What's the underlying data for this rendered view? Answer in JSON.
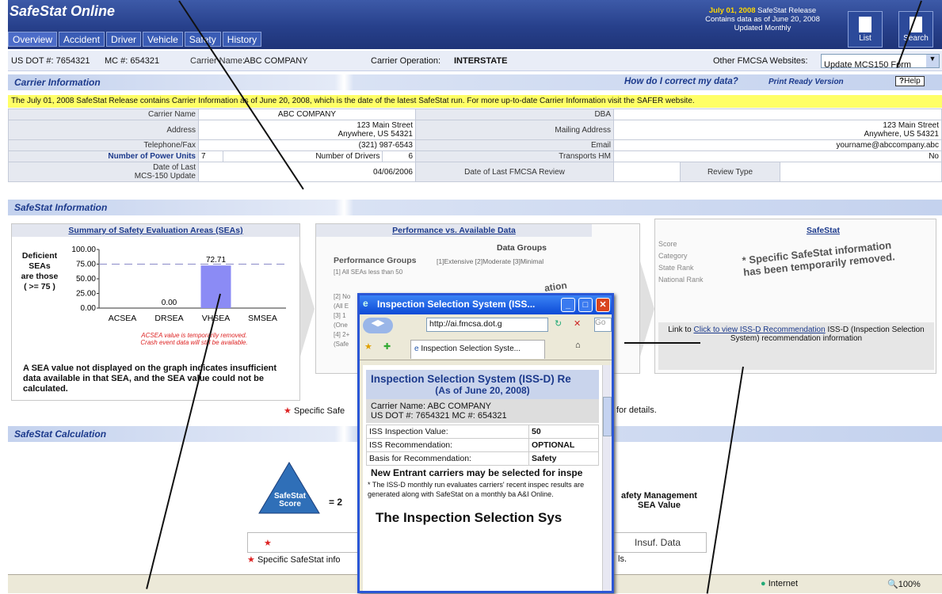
{
  "header": {
    "title": "SafeStat Online",
    "tabs": [
      "Overview",
      "Accident",
      "Driver",
      "Vehicle",
      "Safety",
      "History"
    ],
    "release_line1": "July 01, 2008",
    "release_line1b": "SafeStat Release",
    "release_line2": "Contains data as of June 20, 2008",
    "release_line3": "Updated Monthly",
    "list_label": "List",
    "search_label": "Search"
  },
  "carrier_row": {
    "usdot": "US DOT #: 7654321",
    "mc": "MC #: 654321",
    "name_label": "Carrier Name:",
    "name": "ABC COMPANY",
    "operation_label": "Carrier Operation:",
    "operation": "INTERSTATE",
    "websites_label": "Other FMCSA Websites:",
    "websites_value": "Update MCS150 Form"
  },
  "carrier_info": {
    "title": "Carrier Information",
    "correct_link": "How do I correct my data?",
    "print_link": "Print Ready Version",
    "help": "Help",
    "notice": "The July 01, 2008 SafeStat Release contains Carrier Information as of June 20, 2008, which is the date of the latest SafeStat run.  For more up-to-date Carrier Information visit the SAFER website.",
    "carrier_name_label": "Carrier Name",
    "carrier_name": "ABC COMPANY",
    "dba_label": "DBA",
    "dba": "",
    "address_label": "Address",
    "address1": "123 Main Street",
    "address2": "Anywhere, US 54321",
    "mailing_label": "Mailing Address",
    "mailing1": "123 Main Street",
    "mailing2": "Anywhere, US 54321",
    "phone_label": "Telephone/Fax",
    "phone": "(321) 987-6543",
    "email_label": "Email",
    "email": "yourname@abccompany.abc",
    "power_units_label": "Number of Power Units",
    "power_units": "7",
    "drivers_label": "Number of Drivers",
    "drivers": "6",
    "hm_label": "Transports HM",
    "hm": "No",
    "mcs_label1": "Date of Last",
    "mcs_label2": "MCS-150 Update",
    "mcs_date": "04/06/2006",
    "review_label": "Date of Last FMCSA Review",
    "review": "",
    "review_type_label": "Review Type",
    "review_type": ""
  },
  "safestat_info": {
    "title": "SafeStat Information",
    "sea_panel_title": "Summary of Safety Evaluation Areas (SEAs)",
    "deficient_text": [
      "Deficient",
      "SEAs",
      "are those",
      "( >= 75 )"
    ],
    "sea_note_red1": "ACSEA value is temporarily removed.",
    "sea_note_red2": "Crash event data will still be available.",
    "sea_note": "A SEA value not displayed on the graph indicates insufficient data available in that SEA, and the SEA value could not be calculated.",
    "perf_title": "Performance vs. Available Data",
    "data_groups": "Data Groups",
    "perf_groups": "Performance Groups",
    "dg_cols": "[1]Extensive [2]Moderate [3]Minimal",
    "perf_rows": [
      "[1] All SEAs less than 50",
      "[2] No",
      "(All E",
      "[3] 1",
      "(One",
      "[4] 2+",
      "(Safe"
    ],
    "perf_overlay": "ation",
    "ss_title": "SafeStat",
    "ss_labels": [
      "Score",
      "Category",
      "State Rank",
      "National Rank"
    ],
    "removed_text": "* Specific SafeStat information has been temporarily removed.",
    "link_pre": "Link to",
    "link_text": "Click to view ISS-D Recommendation",
    "link_post": "ISS-D (Inspection Selection System) recommendation information",
    "footnote": "Specific Safe",
    "footnote_end": "for details."
  },
  "calc": {
    "title": "SafeStat Calculation",
    "score_label": "SafeStat Score",
    "eq": "= 2",
    "sm_label": "afety Management SEA Value",
    "insuf": "Insuf. Data",
    "star": "★",
    "footnote": "Specific SafeStat info",
    "footnote_end": "ls."
  },
  "popup": {
    "window_title": "Inspection Selection System (ISS...",
    "url": "http://ai.fmcsa.dot.g",
    "search_placeholder": "Go",
    "tab_label": "Inspection Selection Syste...",
    "heading": "Inspection Selection System (ISS-D) Re",
    "subheading": "(As of June 20, 2008)",
    "carrier_line": "Carrier Name:  ABC COMPANY",
    "dot_line": "US DOT #:  7654321     MC #:  654321",
    "rows": [
      {
        "k": "ISS Inspection Value:",
        "v": "50"
      },
      {
        "k": "ISS Recommendation:",
        "v": "OPTIONAL"
      },
      {
        "k": "Basis for Recommendation:",
        "v": "Safety"
      }
    ],
    "new_entrant": "New Entrant carriers may be selected for inspe",
    "body_text": "* The ISS-D monthly run evaluates carriers' recent inspec results are generated along with SafeStat on a monthly ba A&I Online.",
    "big_heading": "The Inspection Selection Sys"
  },
  "status": {
    "zone": "Internet",
    "zoom": "100%"
  },
  "chart_data": {
    "type": "bar",
    "title": "",
    "categories": [
      "ACSEA",
      "DRSEA",
      "VHSEA",
      "SMSEA"
    ],
    "values": [
      null,
      0.0,
      72.71,
      null
    ],
    "data_labels": [
      "",
      "0.00",
      "72.71",
      ""
    ],
    "ylim": [
      0,
      100
    ],
    "yticks": [
      "100.00",
      "75.00",
      "50.00",
      "25.00",
      "0.00"
    ],
    "threshold": 75,
    "bar_color": "#8b8bf5"
  }
}
